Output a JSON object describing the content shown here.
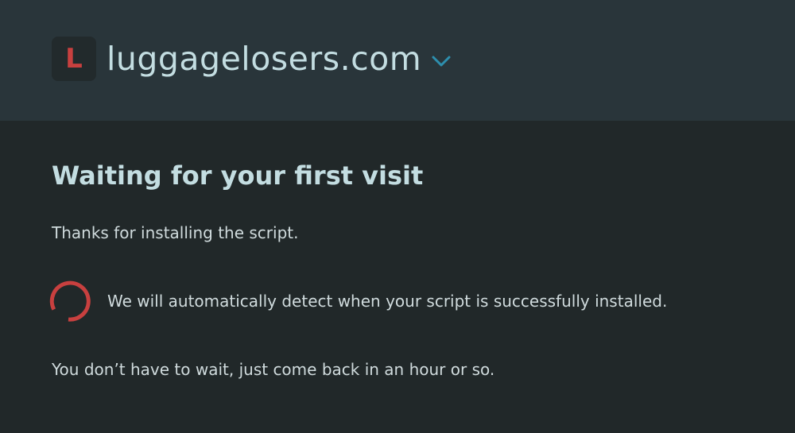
{
  "header": {
    "favicon_letter": "L",
    "site_name": "luggagelosers.com",
    "dropdown_icon": "chevron-down-icon"
  },
  "main": {
    "title": "Waiting for your first visit",
    "thanks_text": "Thanks for installing the script.",
    "detect_text": "We will automatically detect when your script is successfully installed.",
    "wait_note": "You don’t have to wait, just come back in an hour or so."
  },
  "colors": {
    "header_bg": "#29353a",
    "page_bg": "#212829",
    "favicon_letter": "#c8403f",
    "spinner": "#c8403f",
    "chevron": "#2d8fae",
    "title_text": "#c3dde1",
    "body_text": "#d0dbdd"
  }
}
